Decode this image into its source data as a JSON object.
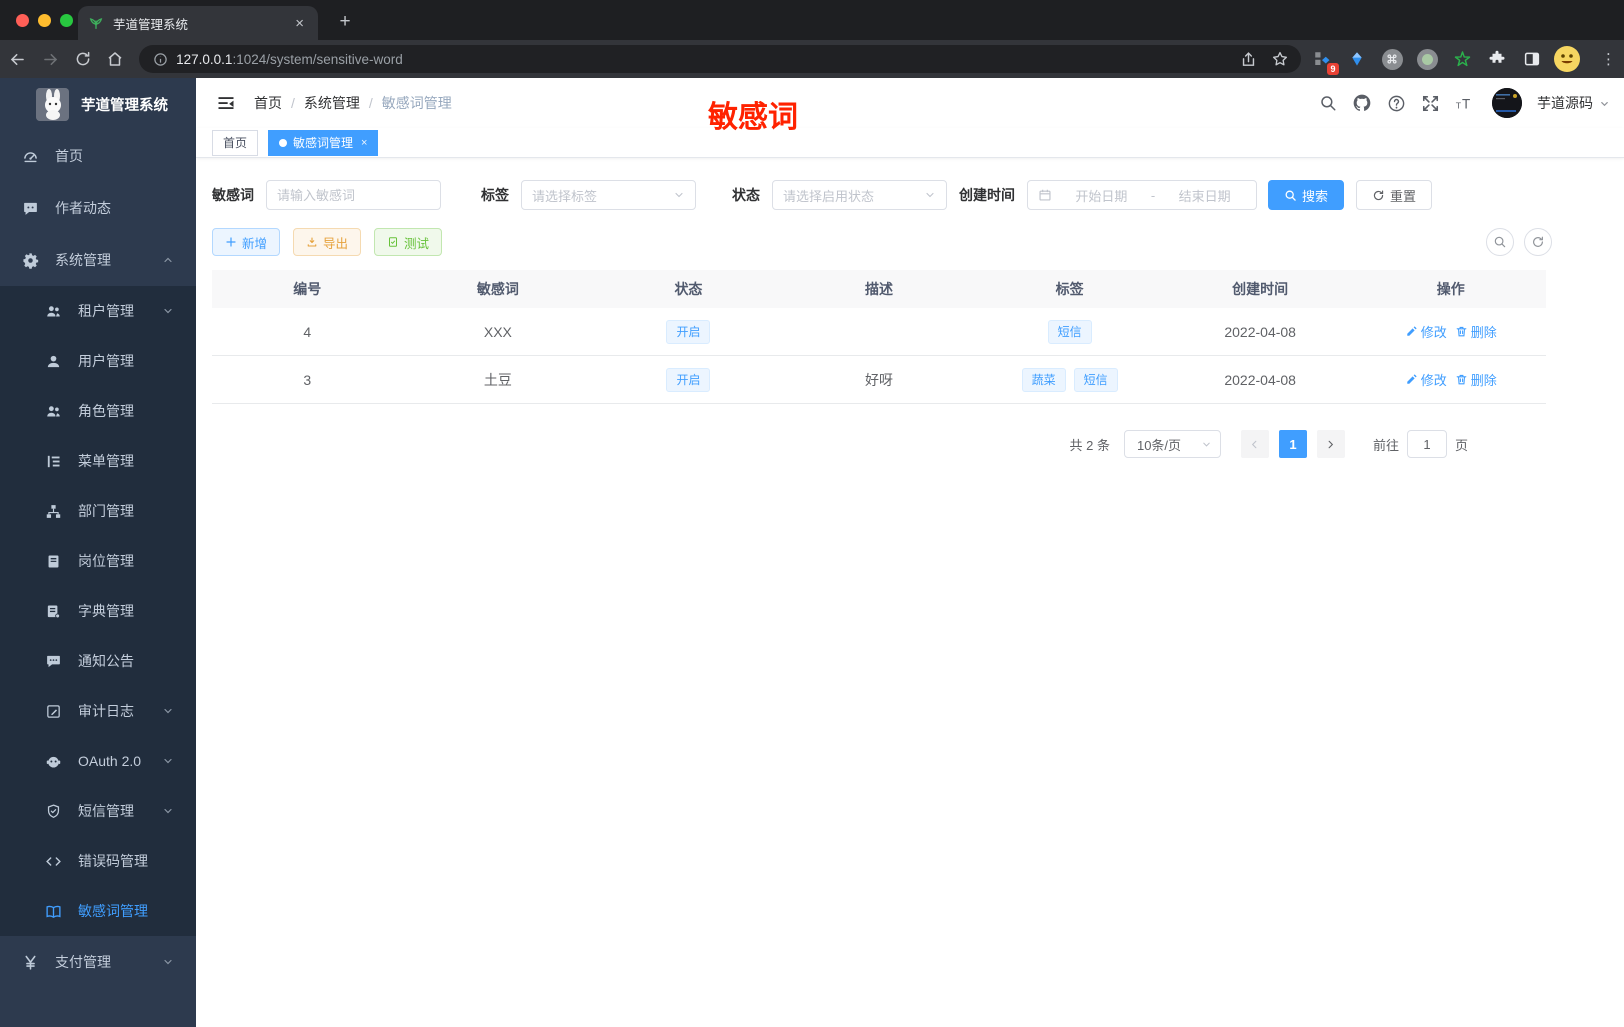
{
  "browser": {
    "tab_title": "芋道管理系统",
    "url_host": "127.0.0.1",
    "url_rest": ":1024/system/sensitive-word",
    "extension_badge": "9"
  },
  "glyphs": {
    "close": "×",
    "plus": "+",
    "dots": "⋮",
    "caret": "▾",
    "slash": "/",
    "dash": "-",
    "yen": "¥",
    "code": "</>",
    "question": "?"
  },
  "colors": {
    "accent": "#409eff",
    "warning": "#e6a23c",
    "success": "#67c23a",
    "watermark": "#ff2200",
    "sidebar_bg": "#2d3a4e",
    "submenu_bg": "#212d3d"
  },
  "sidebar": {
    "title": "芋道管理系统",
    "items": [
      {
        "label": "首页",
        "icon": "dashboard-icon"
      },
      {
        "label": "作者动态",
        "icon": "chat-icon"
      },
      {
        "label": "系统管理",
        "icon": "gear-icon",
        "chevron": "up"
      },
      {
        "label": "租户管理",
        "icon": "tenant-icon",
        "chevron": "down"
      },
      {
        "label": "用户管理",
        "icon": "user-icon"
      },
      {
        "label": "角色管理",
        "icon": "role-icon"
      },
      {
        "label": "菜单管理",
        "icon": "menu-tree-icon"
      },
      {
        "label": "部门管理",
        "icon": "sitemap-icon"
      },
      {
        "label": "岗位管理",
        "icon": "badge-icon"
      },
      {
        "label": "字典管理",
        "icon": "dict-icon"
      },
      {
        "label": "通知公告",
        "icon": "comment-icon"
      },
      {
        "label": "审计日志",
        "icon": "log-icon",
        "chevron": "down"
      },
      {
        "label": "OAuth 2.0",
        "icon": "oauth-icon",
        "chevron": "down"
      },
      {
        "label": "短信管理",
        "icon": "shield-icon",
        "chevron": "down"
      },
      {
        "label": "错误码管理",
        "icon": "code-icon"
      },
      {
        "label": "敏感词管理",
        "icon": "book-icon",
        "active": true
      },
      {
        "label": "支付管理",
        "icon": "yen-icon",
        "chevron": "down"
      }
    ]
  },
  "navbar": {
    "breadcrumb": [
      "首页",
      "系统管理",
      "敏感词管理"
    ],
    "user": "芋道源码"
  },
  "watermark": {
    "text": "敏感词"
  },
  "tags": {
    "items": [
      {
        "label": "首页"
      },
      {
        "label": "敏感词管理",
        "active": true
      }
    ]
  },
  "filter": {
    "word_label": "敏感词",
    "word_placeholder": "请输入敏感词",
    "tag_label": "标签",
    "tag_placeholder": "请选择标签",
    "status_label": "状态",
    "status_placeholder": "请选择启用状态",
    "time_label": "创建时间",
    "start_placeholder": "开始日期",
    "range_sep": "-",
    "end_placeholder": "结束日期",
    "search": "搜索",
    "reset": "重置"
  },
  "actions": {
    "add": "新增",
    "export": "导出",
    "test": "测试"
  },
  "table": {
    "headers": [
      "编号",
      "敏感词",
      "状态",
      "描述",
      "标签",
      "创建时间",
      "操作"
    ],
    "rows": [
      {
        "id": "4",
        "word": "XXX",
        "status": "开启",
        "desc": "",
        "tags": [
          "短信"
        ],
        "created": "2022-04-08",
        "edit": "修改",
        "del": "删除"
      },
      {
        "id": "3",
        "word": "土豆",
        "status": "开启",
        "desc": "好呀",
        "tags": [
          "蔬菜",
          "短信"
        ],
        "created": "2022-04-08",
        "edit": "修改",
        "del": "删除"
      }
    ]
  },
  "pagination": {
    "total": "共 2 条",
    "page_size": "10条/页",
    "current": "1",
    "goto_label": "前往",
    "goto_value": "1",
    "unit": "页"
  }
}
